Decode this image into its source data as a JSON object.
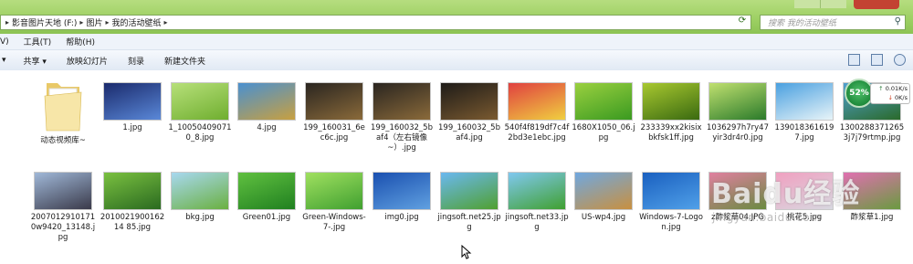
{
  "window": {
    "breadcrumb": [
      "影音图片天地 (F:)",
      "图片",
      "我的活动壁纸"
    ],
    "search_placeholder": "搜索 我的活动壁纸"
  },
  "menu": [
    "V)",
    "工具(T)",
    "帮助(H)"
  ],
  "toolbar": [
    "共享 ▾",
    "放映幻灯片",
    "刻录",
    "新建文件夹"
  ],
  "network": {
    "percent": "52%",
    "up": "0.01K/s",
    "down": "0K/s"
  },
  "watermark": {
    "logo": "Baidu经验",
    "sub": "jingyan.baidu.com"
  },
  "files_row1": [
    {
      "name": "动态视频库~",
      "icon": "folder-icon",
      "colors": [
        "#f7e6a8",
        "#e9c968"
      ]
    },
    {
      "name": "1.jpg",
      "icon": "image-thumbnail",
      "colors": [
        "#1a2a6c",
        "#5a88d8"
      ]
    },
    {
      "name": "1_100504090710_8.jpg",
      "icon": "image-thumbnail",
      "colors": [
        "#b7e07a",
        "#6fae2f"
      ]
    },
    {
      "name": "4.jpg",
      "icon": "image-thumbnail",
      "colors": [
        "#4a90d0",
        "#c8a040"
      ]
    },
    {
      "name": "199_160031_6ec6c.jpg",
      "icon": "image-thumbnail",
      "colors": [
        "#2a2520",
        "#8a6a3a"
      ]
    },
    {
      "name": "199_160032_5baf4（左右镜像~）.jpg",
      "icon": "image-thumbnail",
      "colors": [
        "#2a2520",
        "#8a6a3a"
      ]
    },
    {
      "name": "199_160032_5baf4.jpg",
      "icon": "image-thumbnail",
      "colors": [
        "#1e1b18",
        "#7a5a30"
      ]
    },
    {
      "name": "540f4f819df7c4f2bd3e1ebc.jpg",
      "icon": "image-thumbnail",
      "colors": [
        "#e04040",
        "#f0d040"
      ]
    },
    {
      "name": "1680X1050_06.jpg",
      "icon": "image-thumbnail",
      "colors": [
        "#9ad040",
        "#3a9a20"
      ]
    },
    {
      "name": "233339xx2kisixbkfsk1ff.jpg",
      "icon": "image-thumbnail",
      "colors": [
        "#a8c830",
        "#3a6a10"
      ]
    },
    {
      "name": "1036297h7ry47yir3dr4r0.jpg",
      "icon": "image-thumbnail",
      "colors": [
        "#c0e070",
        "#2a7a2a"
      ]
    },
    {
      "name": "1390183616197.jpg",
      "icon": "image-thumbnail",
      "colors": [
        "#4aa0e0",
        "#e8f4f8"
      ]
    },
    {
      "name": "13002883712653j7j79rtmp.jpg",
      "icon": "image-thumbnail",
      "colors": [
        "#50a0d0",
        "#2a6a2a"
      ]
    }
  ],
  "files_row2": [
    {
      "name": "20070129101710w9420_13148.jpg",
      "icon": "image-thumbnail",
      "colors": [
        "#a0b8d8",
        "#3a3a4a"
      ]
    },
    {
      "name": "201002190016214 85.jpg",
      "icon": "image-thumbnail",
      "colors": [
        "#7ac040",
        "#2a6a20"
      ]
    },
    {
      "name": "bkg.jpg",
      "icon": "image-thumbnail",
      "colors": [
        "#a8d8f0",
        "#6ab040"
      ]
    },
    {
      "name": "Green01.jpg",
      "icon": "image-thumbnail",
      "colors": [
        "#60c040",
        "#208020"
      ]
    },
    {
      "name": "Green-Windows-7-.jpg",
      "icon": "image-thumbnail",
      "colors": [
        "#a0e060",
        "#40a030"
      ]
    },
    {
      "name": "img0.jpg",
      "icon": "image-thumbnail",
      "colors": [
        "#1a50b0",
        "#60a0e0"
      ]
    },
    {
      "name": "jingsoft.net25.jpg",
      "icon": "image-thumbnail",
      "colors": [
        "#6ab8f0",
        "#50a030"
      ]
    },
    {
      "name": "jingsoft.net33.jpg",
      "icon": "image-thumbnail",
      "colors": [
        "#80c8f0",
        "#40a030"
      ]
    },
    {
      "name": "US-wp4.jpg",
      "icon": "image-thumbnail",
      "colors": [
        "#70a8e0",
        "#c89040"
      ]
    },
    {
      "name": "Windows-7-Logon.jpg",
      "icon": "image-thumbnail",
      "colors": [
        "#1a60c0",
        "#50a0e8"
      ]
    },
    {
      "name": "z酢浆草04.JPG",
      "icon": "image-thumbnail",
      "colors": [
        "#e080a0",
        "#6a8a40"
      ]
    },
    {
      "name": "桃花5.jpg",
      "icon": "image-thumbnail",
      "colors": [
        "#f0a0c0",
        "#d8d8e0"
      ]
    },
    {
      "name": "酢浆草1.jpg",
      "icon": "image-thumbnail",
      "colors": [
        "#e070b0",
        "#6a9a40"
      ]
    }
  ]
}
